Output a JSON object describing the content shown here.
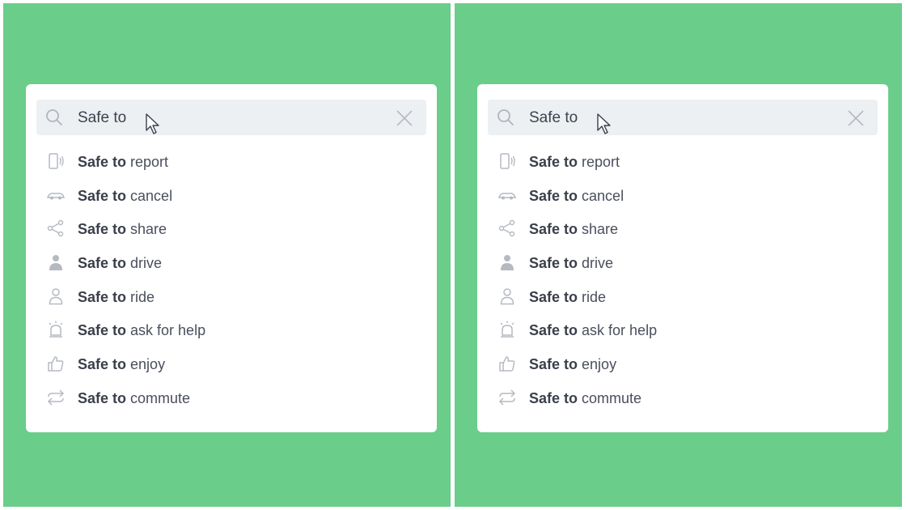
{
  "panels": [
    {
      "search": {
        "query": "Safe to",
        "search_icon": "search-icon",
        "clear_icon": "close-icon"
      },
      "items": [
        {
          "bold": "Safe to",
          "rest": "report",
          "icon": "report-phone-icon"
        },
        {
          "bold": "Safe to",
          "rest": "cancel",
          "icon": "cancel-car-icon"
        },
        {
          "bold": "Safe to",
          "rest": "share",
          "icon": "share-icon"
        },
        {
          "bold": "Safe to",
          "rest": "drive",
          "icon": "driver-icon"
        },
        {
          "bold": "Safe to",
          "rest": "ride",
          "icon": "rider-icon"
        },
        {
          "bold": "Safe to",
          "rest": "ask for help",
          "icon": "alarm-icon"
        },
        {
          "bold": "Safe to",
          "rest": "enjoy",
          "icon": "thumbs-up-icon"
        },
        {
          "bold": "Safe to",
          "rest": "commute",
          "icon": "commute-arrows-icon"
        }
      ]
    },
    {
      "search": {
        "query": "Safe to",
        "search_icon": "search-icon",
        "clear_icon": "close-icon"
      },
      "items": [
        {
          "bold": "Safe to",
          "rest": "report",
          "icon": "report-phone-icon"
        },
        {
          "bold": "Safe to",
          "rest": "cancel",
          "icon": "cancel-car-icon"
        },
        {
          "bold": "Safe to",
          "rest": "share",
          "icon": "share-icon"
        },
        {
          "bold": "Safe to",
          "rest": "drive",
          "icon": "driver-icon"
        },
        {
          "bold": "Safe to",
          "rest": "ride",
          "icon": "rider-icon"
        },
        {
          "bold": "Safe to",
          "rest": "ask for help",
          "icon": "alarm-icon"
        },
        {
          "bold": "Safe to",
          "rest": "enjoy",
          "icon": "thumbs-up-icon"
        },
        {
          "bold": "Safe to",
          "rest": "commute",
          "icon": "commute-arrows-icon"
        }
      ]
    }
  ],
  "colors": {
    "background": "#6acd8a",
    "card": "#ffffff",
    "search_bg": "#edf0f2",
    "text": "#3a3f4b",
    "icon": "#b5bac2"
  }
}
